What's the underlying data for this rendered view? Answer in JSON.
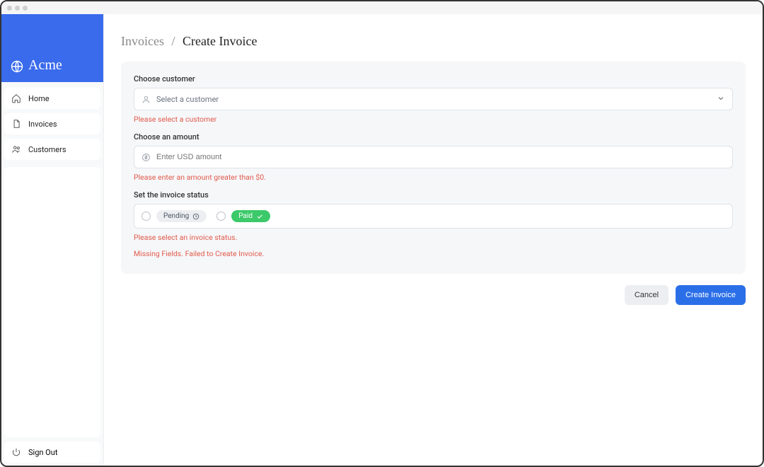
{
  "brand": "Acme",
  "nav": {
    "home": "Home",
    "invoices": "Invoices",
    "customers": "Customers",
    "signout": "Sign Out"
  },
  "breadcrumb": {
    "parent": "Invoices",
    "current": "Create Invoice"
  },
  "form": {
    "customer": {
      "label": "Choose customer",
      "placeholder": "Select a customer",
      "error": "Please select a customer"
    },
    "amount": {
      "label": "Choose an amount",
      "placeholder": "Enter USD amount",
      "error": "Please enter an amount greater than $0."
    },
    "status": {
      "label": "Set the invoice status",
      "pending": "Pending",
      "paid": "Paid",
      "error": "Please select an invoice status."
    },
    "general_error": "Missing Fields. Failed to Create Invoice.",
    "cancel": "Cancel",
    "submit": "Create Invoice"
  }
}
